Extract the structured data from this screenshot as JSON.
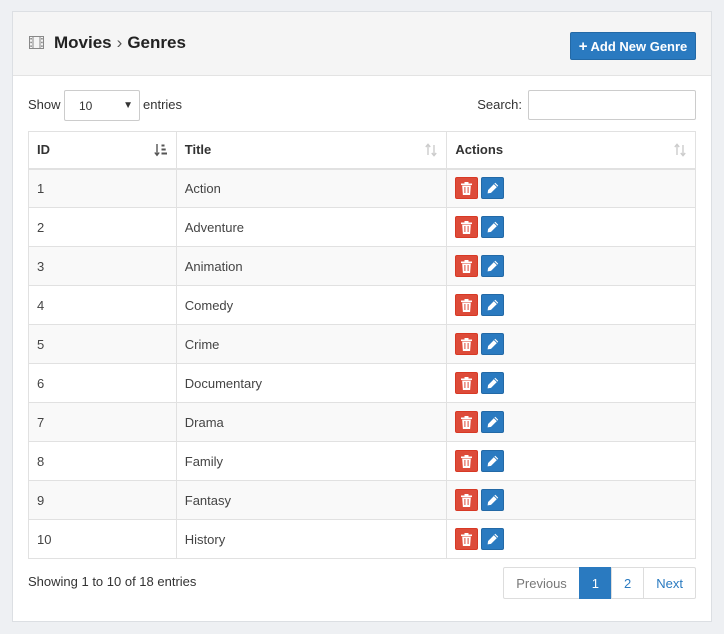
{
  "header": {
    "icon": "film-icon",
    "breadcrumb_parent": "Movies",
    "breadcrumb_separator": "›",
    "breadcrumb_current": "Genres",
    "add_button_icon": "+",
    "add_button_label": "Add New Genre"
  },
  "controls": {
    "show_label": "Show",
    "page_length": "10",
    "entries_label": "entries",
    "search_label": "Search:",
    "search_value": ""
  },
  "table": {
    "columns": [
      "ID",
      "Title",
      "Actions"
    ],
    "rows": [
      {
        "id": "1",
        "title": "Action"
      },
      {
        "id": "2",
        "title": "Adventure"
      },
      {
        "id": "3",
        "title": "Animation"
      },
      {
        "id": "4",
        "title": "Comedy"
      },
      {
        "id": "5",
        "title": "Crime"
      },
      {
        "id": "6",
        "title": "Documentary"
      },
      {
        "id": "7",
        "title": "Drama"
      },
      {
        "id": "8",
        "title": "Family"
      },
      {
        "id": "9",
        "title": "Fantasy"
      },
      {
        "id": "10",
        "title": "History"
      }
    ],
    "row_actions": [
      "trash-icon",
      "pencil-icon"
    ]
  },
  "footer": {
    "info": "Showing 1 to 10 of 18 entries",
    "pagination": {
      "previous": "Previous",
      "pages": [
        "1",
        "2"
      ],
      "active_page": "1",
      "next": "Next"
    }
  },
  "colors": {
    "primary": "#2a7ac0",
    "danger": "#dd4b39"
  }
}
